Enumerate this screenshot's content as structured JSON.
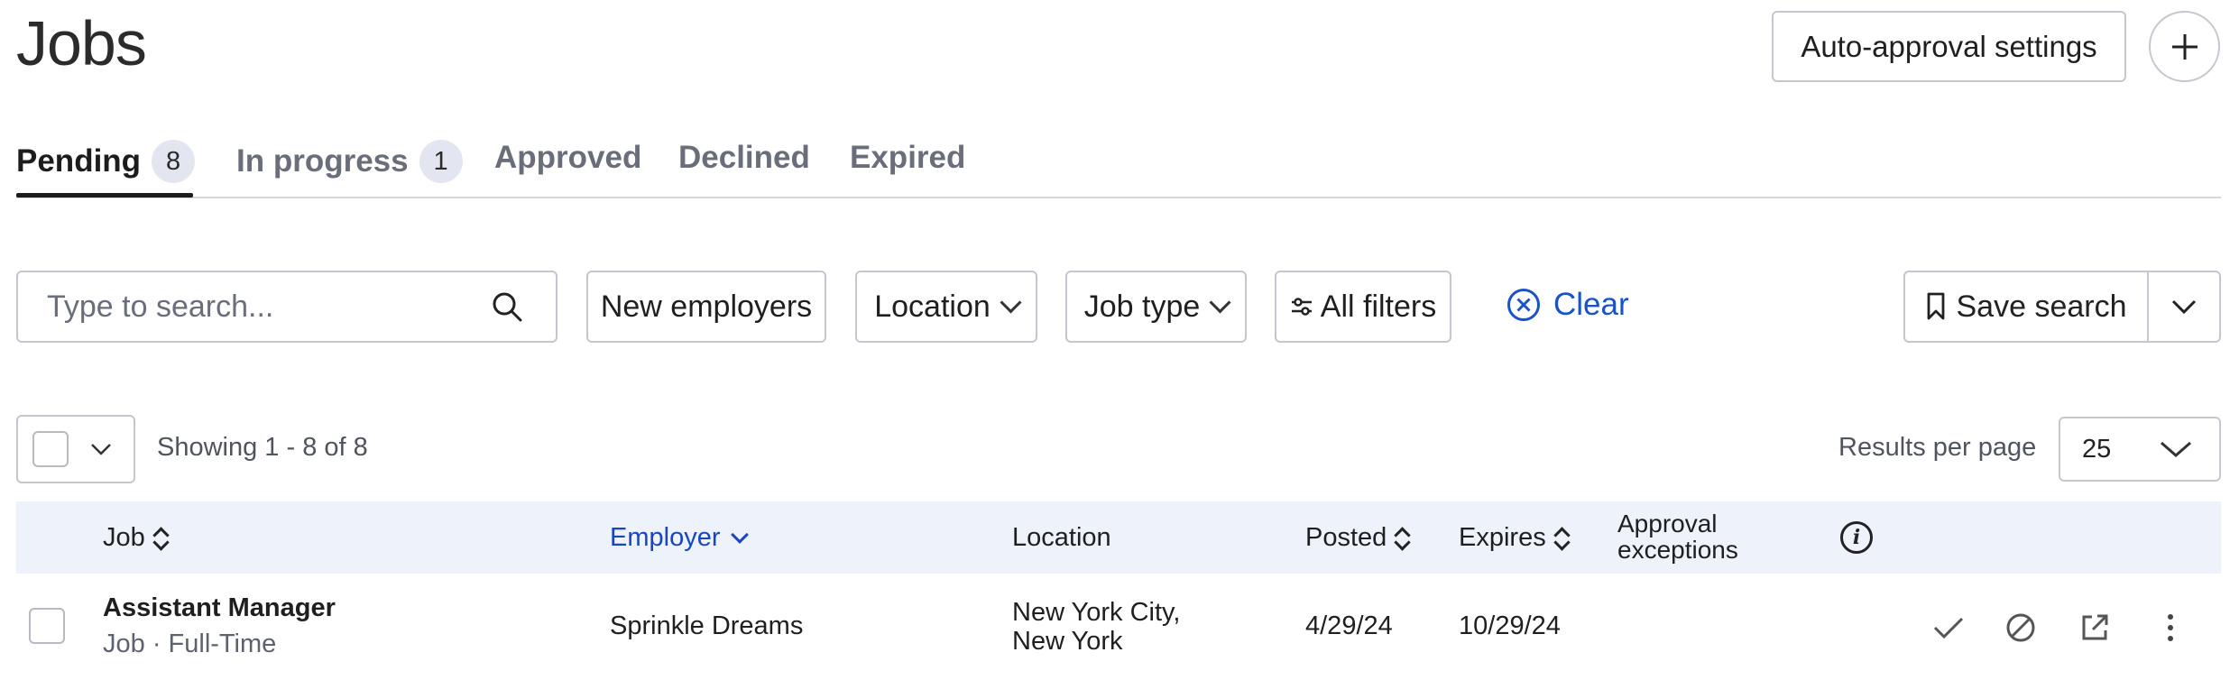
{
  "page": {
    "title": "Jobs"
  },
  "header": {
    "auto_approval_label": "Auto-approval settings",
    "add_icon": "plus-icon"
  },
  "tabs": [
    {
      "label": "Pending",
      "count": "8",
      "active": true
    },
    {
      "label": "In progress",
      "count": "1",
      "active": false
    },
    {
      "label": "Approved",
      "active": false
    },
    {
      "label": "Declined",
      "active": false
    },
    {
      "label": "Expired",
      "active": false
    }
  ],
  "filters": {
    "search_placeholder": "Type to search...",
    "search_value": "",
    "new_employers": "New employers",
    "location": "Location",
    "job_type": "Job type",
    "all_filters": "All filters",
    "clear": "Clear",
    "save_search": "Save search"
  },
  "list": {
    "showing": "Showing 1 - 8 of 8",
    "results_per_page_label": "Results per page",
    "results_per_page_value": "25"
  },
  "table": {
    "headers": {
      "job": "Job",
      "employer": "Employer",
      "location": "Location",
      "posted": "Posted",
      "expires": "Expires",
      "approval_exceptions": "Approval exceptions"
    },
    "rows": [
      {
        "job": "Assistant Manager",
        "job_sub": "Job · Full-Time",
        "employer": "Sprinkle Dreams",
        "location": "New York City, New York",
        "posted": "4/29/24",
        "expires": "10/29/24",
        "approval_exceptions": ""
      }
    ]
  },
  "colors": {
    "accent": "#1a53c7",
    "header_bg": "#eef2fa",
    "border": "#c4c7cf",
    "text": "#1f1f1f",
    "muted": "#6a6e7a"
  }
}
